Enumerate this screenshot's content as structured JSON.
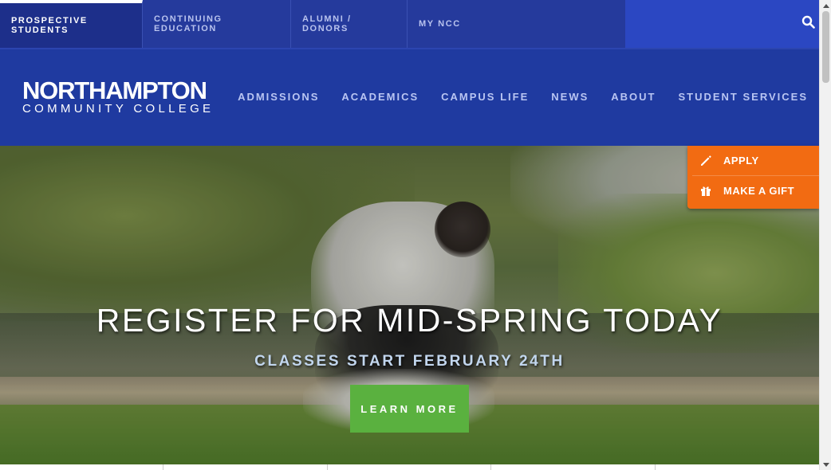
{
  "topbar": {
    "tabs": [
      {
        "label": "PROSPECTIVE STUDENTS",
        "active": true
      },
      {
        "label": "CONTINUING EDUCATION",
        "active": false
      },
      {
        "label": "ALUMNI / DONORS",
        "active": false
      },
      {
        "label": "MY NCC",
        "active": false
      }
    ],
    "search_icon": "search-icon"
  },
  "header": {
    "logo": {
      "line1": "NORTHAMPTON",
      "line2": "COMMUNITY COLLEGE"
    },
    "nav": [
      "ADMISSIONS",
      "ACADEMICS",
      "CAMPUS LIFE",
      "NEWS",
      "ABOUT",
      "STUDENT SERVICES"
    ]
  },
  "quick_actions": [
    {
      "label": "APPLY",
      "icon": "pencil-icon"
    },
    {
      "label": "MAKE A GIFT",
      "icon": "gift-icon"
    }
  ],
  "hero": {
    "title": "REGISTER FOR MID-SPRING TODAY",
    "subtitle": "CLASSES START FEBRUARY 24TH",
    "button": "LEARN MORE"
  },
  "colors": {
    "topbar": "#253a9c",
    "header": "#1f3aa0",
    "accent_orange": "#f26b12",
    "button_green": "#5ab13f"
  }
}
